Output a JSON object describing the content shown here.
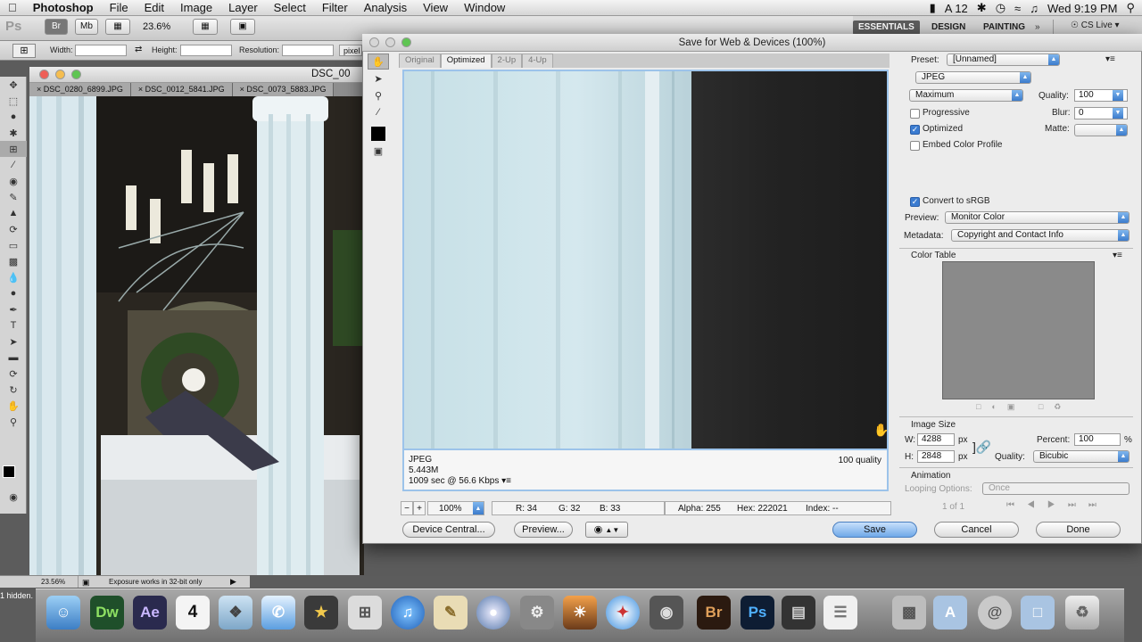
{
  "menubar": {
    "app": "Photoshop",
    "items": [
      "File",
      "Edit",
      "Image",
      "Layer",
      "Select",
      "Filter",
      "Analysis",
      "View",
      "Window"
    ],
    "right": {
      "input_badge": "A 12",
      "clock": "Wed 9:19 PM"
    }
  },
  "optionsbar": {
    "ps_logo": "Ps",
    "br_button": "Br",
    "mb_button": "Mb",
    "zoom": "23.6%",
    "width_label": "Width:",
    "height_label": "Height:",
    "resolution_label": "Resolution:",
    "units": "pixel",
    "workspaces": [
      "ESSENTIALS",
      "DESIGN",
      "PAINTING"
    ],
    "cslive": "CS Live"
  },
  "document": {
    "title": "DSC_00",
    "tabs": [
      "DSC_0280_6899.JPG",
      "DSC_0012_5841.JPG",
      "DSC_0073_5883.JPG"
    ],
    "zoom": "23.56%",
    "status": "Exposure works in 32-bit only",
    "hidden_label": "1 hidden."
  },
  "dialog": {
    "title": "Save for Web & Devices (100%)",
    "tabs": [
      "Original",
      "Optimized",
      "2-Up",
      "4-Up"
    ],
    "active_tab": "Optimized",
    "info": {
      "format": "JPEG",
      "size": "5.443M",
      "time": "1009 sec @ 56.6 Kbps",
      "quality": "100 quality"
    },
    "statusbar": {
      "zoom": "100%",
      "r": "R: 34",
      "g": "G: 32",
      "b": "B: 33",
      "alpha": "Alpha: 255",
      "hex": "Hex: 222021",
      "index": "Index: --"
    },
    "buttons": {
      "device_central": "Device Central...",
      "preview": "Preview...",
      "save": "Save",
      "cancel": "Cancel",
      "done": "Done"
    }
  },
  "settings": {
    "preset_label": "Preset:",
    "preset_value": "[Unnamed]",
    "format": "JPEG",
    "compression": "Maximum",
    "quality_label": "Quality:",
    "quality_value": "100",
    "blur_label": "Blur:",
    "blur_value": "0",
    "matte_label": "Matte:",
    "progressive_label": "Progressive",
    "progressive_checked": false,
    "optimized_label": "Optimized",
    "optimized_checked": true,
    "embed_label": "Embed Color Profile",
    "embed_checked": false,
    "srgb_label": "Convert to sRGB",
    "srgb_checked": true,
    "preview_label": "Preview:",
    "preview_value": "Monitor Color",
    "metadata_label": "Metadata:",
    "metadata_value": "Copyright and Contact Info",
    "color_table_label": "Color Table",
    "image_size_label": "Image Size",
    "w_label": "W:",
    "w_value": "4288",
    "h_label": "H:",
    "h_value": "2848",
    "px": "px",
    "percent_label": "Percent:",
    "percent_value": "100",
    "percent_unit": "%",
    "resample_label": "Quality:",
    "resample_value": "Bicubic",
    "animation_label": "Animation",
    "looping_label": "Looping Options:",
    "looping_value": "Once",
    "frame_counter": "1 of 1"
  },
  "dock": {
    "dw": "Dw",
    "ae": "Ae",
    "cal": "4",
    "br": "Br",
    "ps": "Ps"
  }
}
